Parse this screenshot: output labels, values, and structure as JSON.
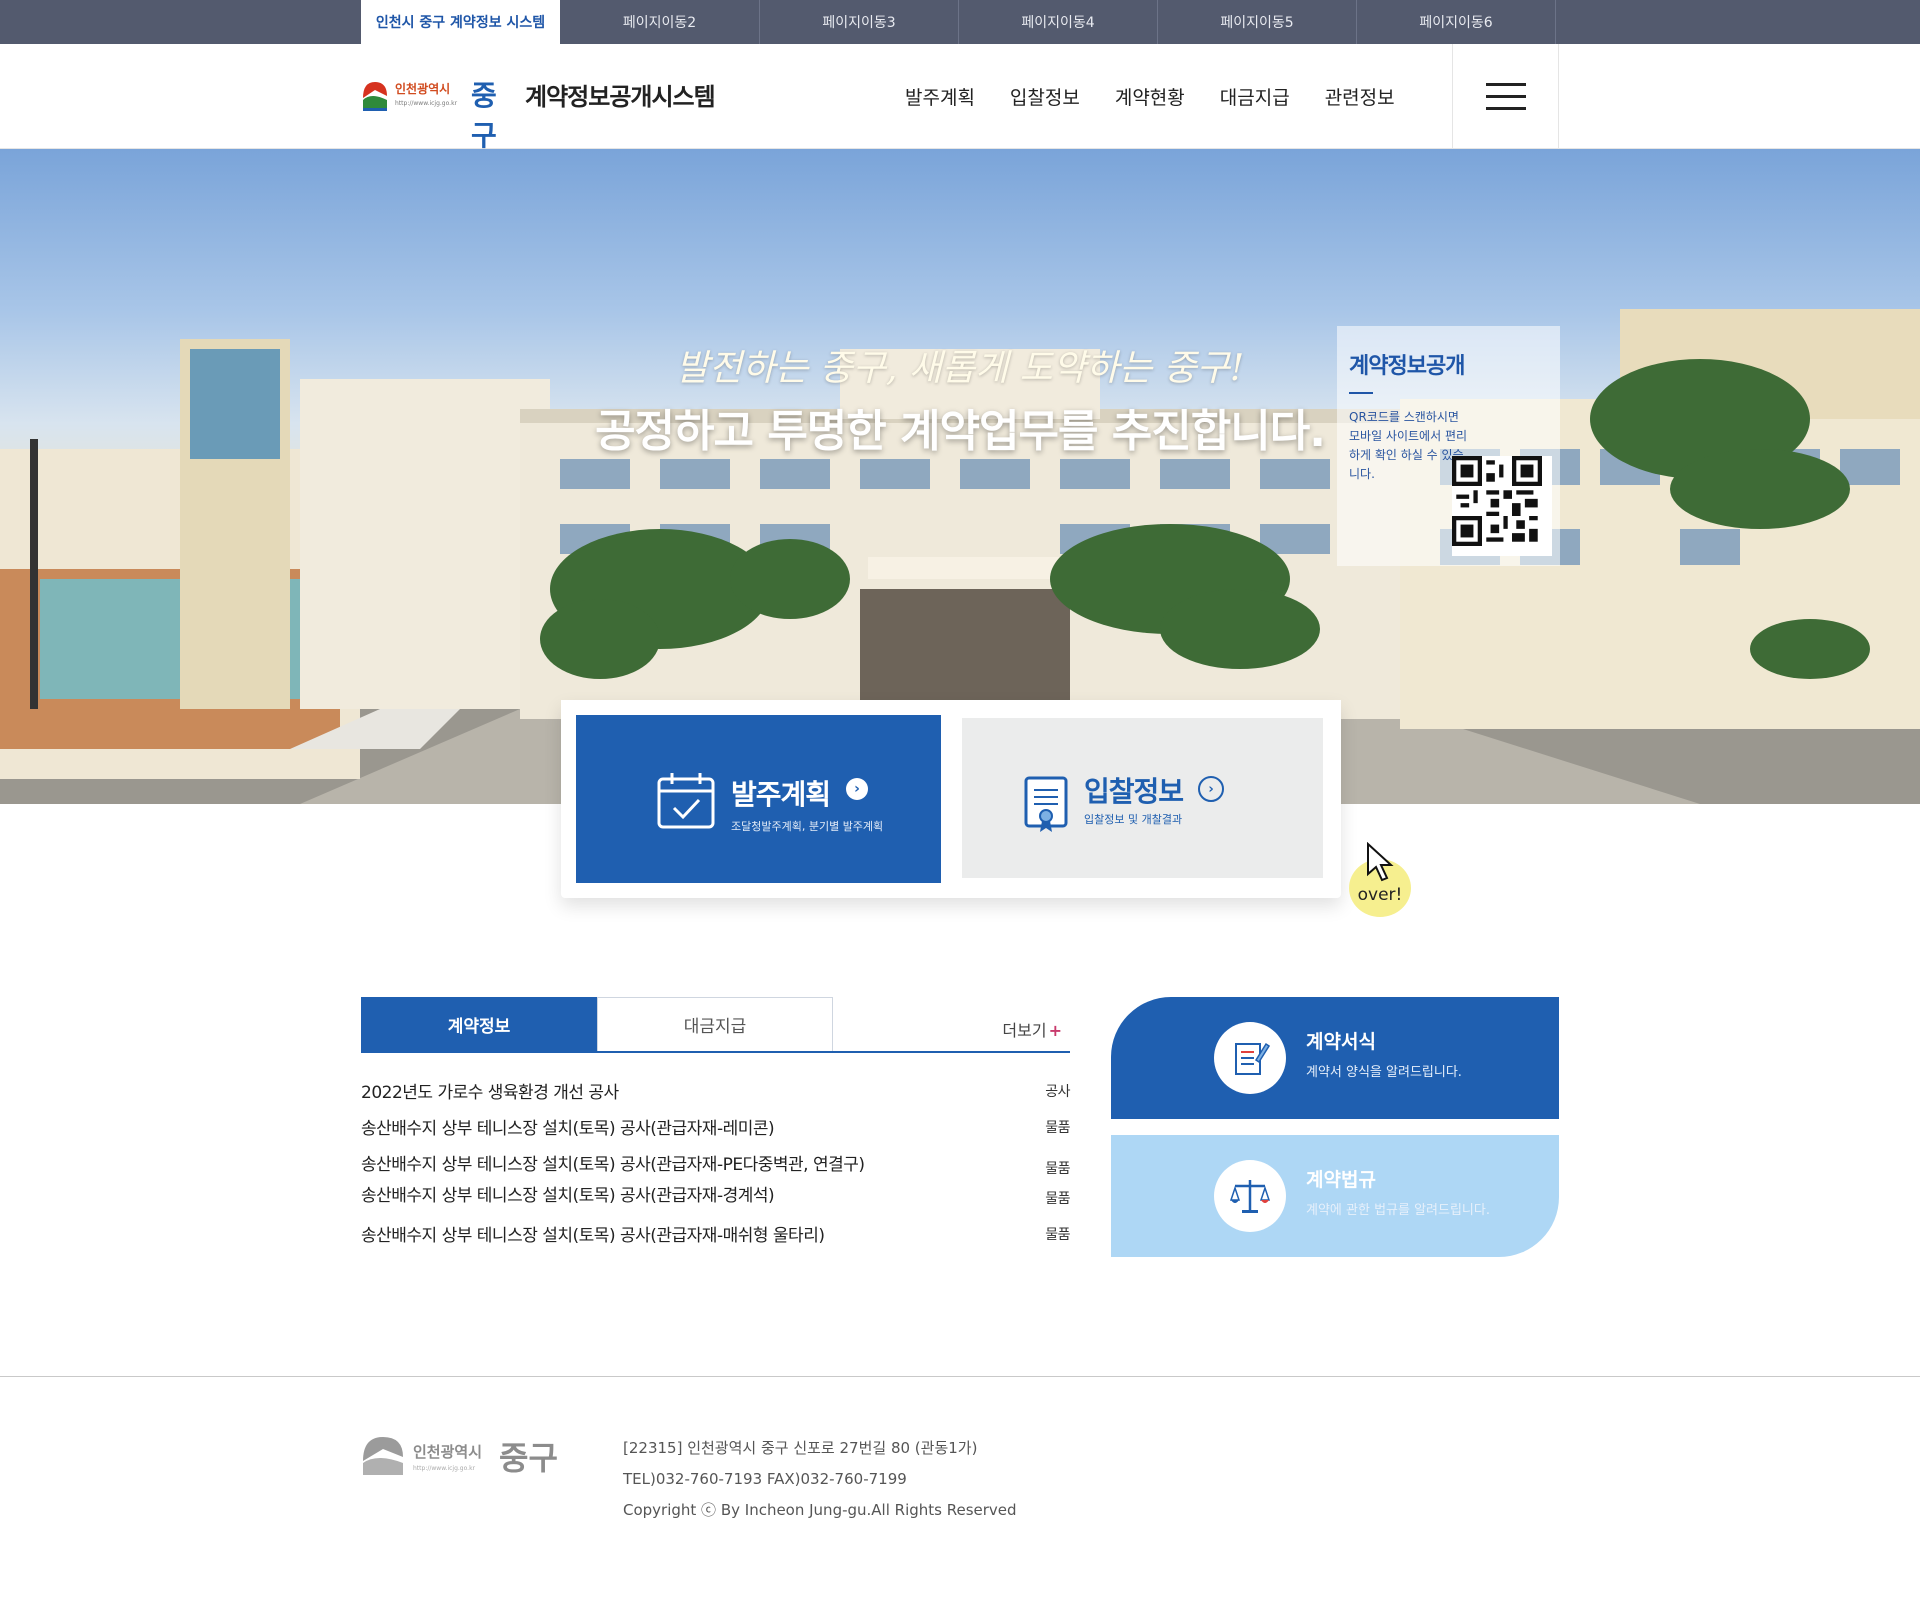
{
  "utilbar": {
    "tabs": [
      "인천시 중구 계약정보 시스템",
      "페이지이동2",
      "페이지이동3",
      "페이지이동4",
      "페이지이동5",
      "페이지이동6"
    ]
  },
  "header": {
    "logo": {
      "city": "인천광역시",
      "gu": "중구",
      "url": "http://www.icjg.go.kr"
    },
    "title": "계약정보공개시스템",
    "menu": [
      "발주계획",
      "입찰정보",
      "계약현황",
      "대금지급",
      "관련정보"
    ]
  },
  "hero": {
    "slogan": "발전하는 중구, 새롭게 도약하는 중구!",
    "headline": "공정하고 투명한 계약업무를 추진합니다.",
    "qr": {
      "title": "계약정보공개",
      "desc": "QR코드를 스캔하시면 모바일 사이트에서 편리하게 확인 하실 수 있습니다."
    }
  },
  "quick": [
    {
      "title": "발주계획",
      "sub": "조달청발주계획, 분기별 발주계획"
    },
    {
      "title": "입찰정보",
      "sub": "입찰정보 및 개찰결과"
    }
  ],
  "over_label": "over!",
  "board": {
    "tabs": [
      "계약정보",
      "대금지급"
    ],
    "more": "더보기",
    "items": [
      {
        "title": "2022년도 가로수 생육환경 개선 공사",
        "cat": "공사"
      },
      {
        "title": "송산배수지 상부 테니스장 설치(토목) 공사(관급자재-레미콘)",
        "cat": "물품"
      },
      {
        "title": "송산배수지 상부 테니스장 설치(토목) 공사(관급자재-PE다중벽관, 연결구)",
        "cat": "물품"
      },
      {
        "title": "송산배수지 상부 테니스장 설치(토목) 공사(관급자재-경계석)",
        "cat": "물품"
      },
      {
        "title": "송산배수지 상부 테니스장 설치(토목) 공사(관급자재-매쉬형 울타리)",
        "cat": "물품"
      }
    ]
  },
  "side": [
    {
      "title": "계약서식",
      "desc": "계약서 양식을 알려드립니다."
    },
    {
      "title": "계약법규",
      "desc": "계약에 관한 법규를 알려드립니다."
    }
  ],
  "footer": {
    "address": "[22315] 인천광역시 중구 신포로 27번길 80 (관동1가)",
    "tel": "TEL)032-760-7193 FAX)032-760-7199",
    "copyright": "Copyright ⓒ By Incheon Jung-gu.All Rights Reserved"
  },
  "colors": {
    "primary": "#1f5fb0",
    "utilbar": "#535a6e",
    "light_blue": "#aed7f5",
    "over": "#f6ef8f"
  }
}
